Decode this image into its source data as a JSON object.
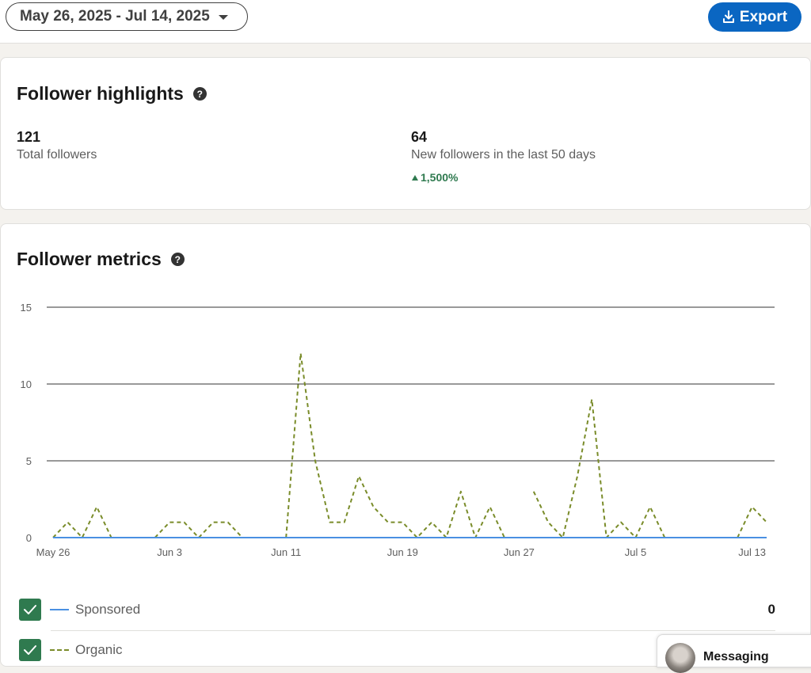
{
  "toolbar": {
    "date_range": "May 26, 2025 - Jul 14, 2025",
    "export_label": "Export"
  },
  "highlights": {
    "title": "Follower highlights",
    "help_icon": "question-circle-icon",
    "total": {
      "value": "121",
      "label": "Total followers"
    },
    "new": {
      "value": "64",
      "label": "New followers in the last 50 days",
      "change": "1,500%",
      "change_direction": "up"
    }
  },
  "metrics": {
    "title": "Follower metrics",
    "help_icon": "question-circle-icon",
    "legend": [
      {
        "name": "Sponsored",
        "value": "0",
        "checked": true,
        "color": "#4a90e2",
        "style": "solid"
      },
      {
        "name": "Organic",
        "value": "",
        "checked": true,
        "color": "#7a8c2a",
        "style": "dashed"
      }
    ]
  },
  "chart_data": {
    "type": "line",
    "x": [
      "May 26",
      "May 27",
      "May 28",
      "May 29",
      "May 30",
      "May 31",
      "Jun 1",
      "Jun 2",
      "Jun 3",
      "Jun 4",
      "Jun 5",
      "Jun 6",
      "Jun 7",
      "Jun 8",
      "Jun 9",
      "Jun 10",
      "Jun 11",
      "Jun 12",
      "Jun 13",
      "Jun 14",
      "Jun 15",
      "Jun 16",
      "Jun 17",
      "Jun 18",
      "Jun 19",
      "Jun 20",
      "Jun 21",
      "Jun 22",
      "Jun 23",
      "Jun 24",
      "Jun 25",
      "Jun 26",
      "Jun 27",
      "Jun 28",
      "Jun 29",
      "Jun 30",
      "Jul 1",
      "Jul 2",
      "Jul 3",
      "Jul 4",
      "Jul 5",
      "Jul 6",
      "Jul 7",
      "Jul 8",
      "Jul 9",
      "Jul 10",
      "Jul 11",
      "Jul 12",
      "Jul 13",
      "Jul 14"
    ],
    "xticks": [
      "May 26",
      "Jun 3",
      "Jun 11",
      "Jun 19",
      "Jun 27",
      "Jul 5",
      "Jul 13"
    ],
    "series": [
      {
        "name": "Sponsored",
        "values": [
          0,
          0,
          0,
          0,
          0,
          0,
          0,
          0,
          0,
          0,
          0,
          0,
          0,
          0,
          0,
          0,
          0,
          0,
          0,
          0,
          0,
          0,
          0,
          0,
          0,
          0,
          0,
          0,
          0,
          0,
          0,
          0,
          0,
          0,
          0,
          0,
          0,
          0,
          0,
          0,
          0,
          0,
          0,
          0,
          0,
          0,
          0,
          0,
          0,
          0
        ],
        "color": "#4a90e2",
        "style": "solid"
      },
      {
        "name": "Organic",
        "values": [
          0,
          1,
          0,
          2,
          0,
          null,
          null,
          0,
          1,
          1,
          0,
          1,
          1,
          0,
          null,
          null,
          0,
          12,
          5,
          1,
          1,
          4,
          2,
          1,
          1,
          0,
          1,
          0,
          3,
          0,
          2,
          0,
          null,
          3,
          1,
          0,
          4,
          9,
          0,
          1,
          0,
          2,
          0,
          null,
          null,
          null,
          null,
          0,
          2,
          1
        ],
        "color": "#7a8c2a",
        "style": "dashed"
      }
    ],
    "ylim": [
      0,
      15
    ],
    "yticks": [
      0,
      5,
      10,
      15
    ],
    "grid": true
  }
}
